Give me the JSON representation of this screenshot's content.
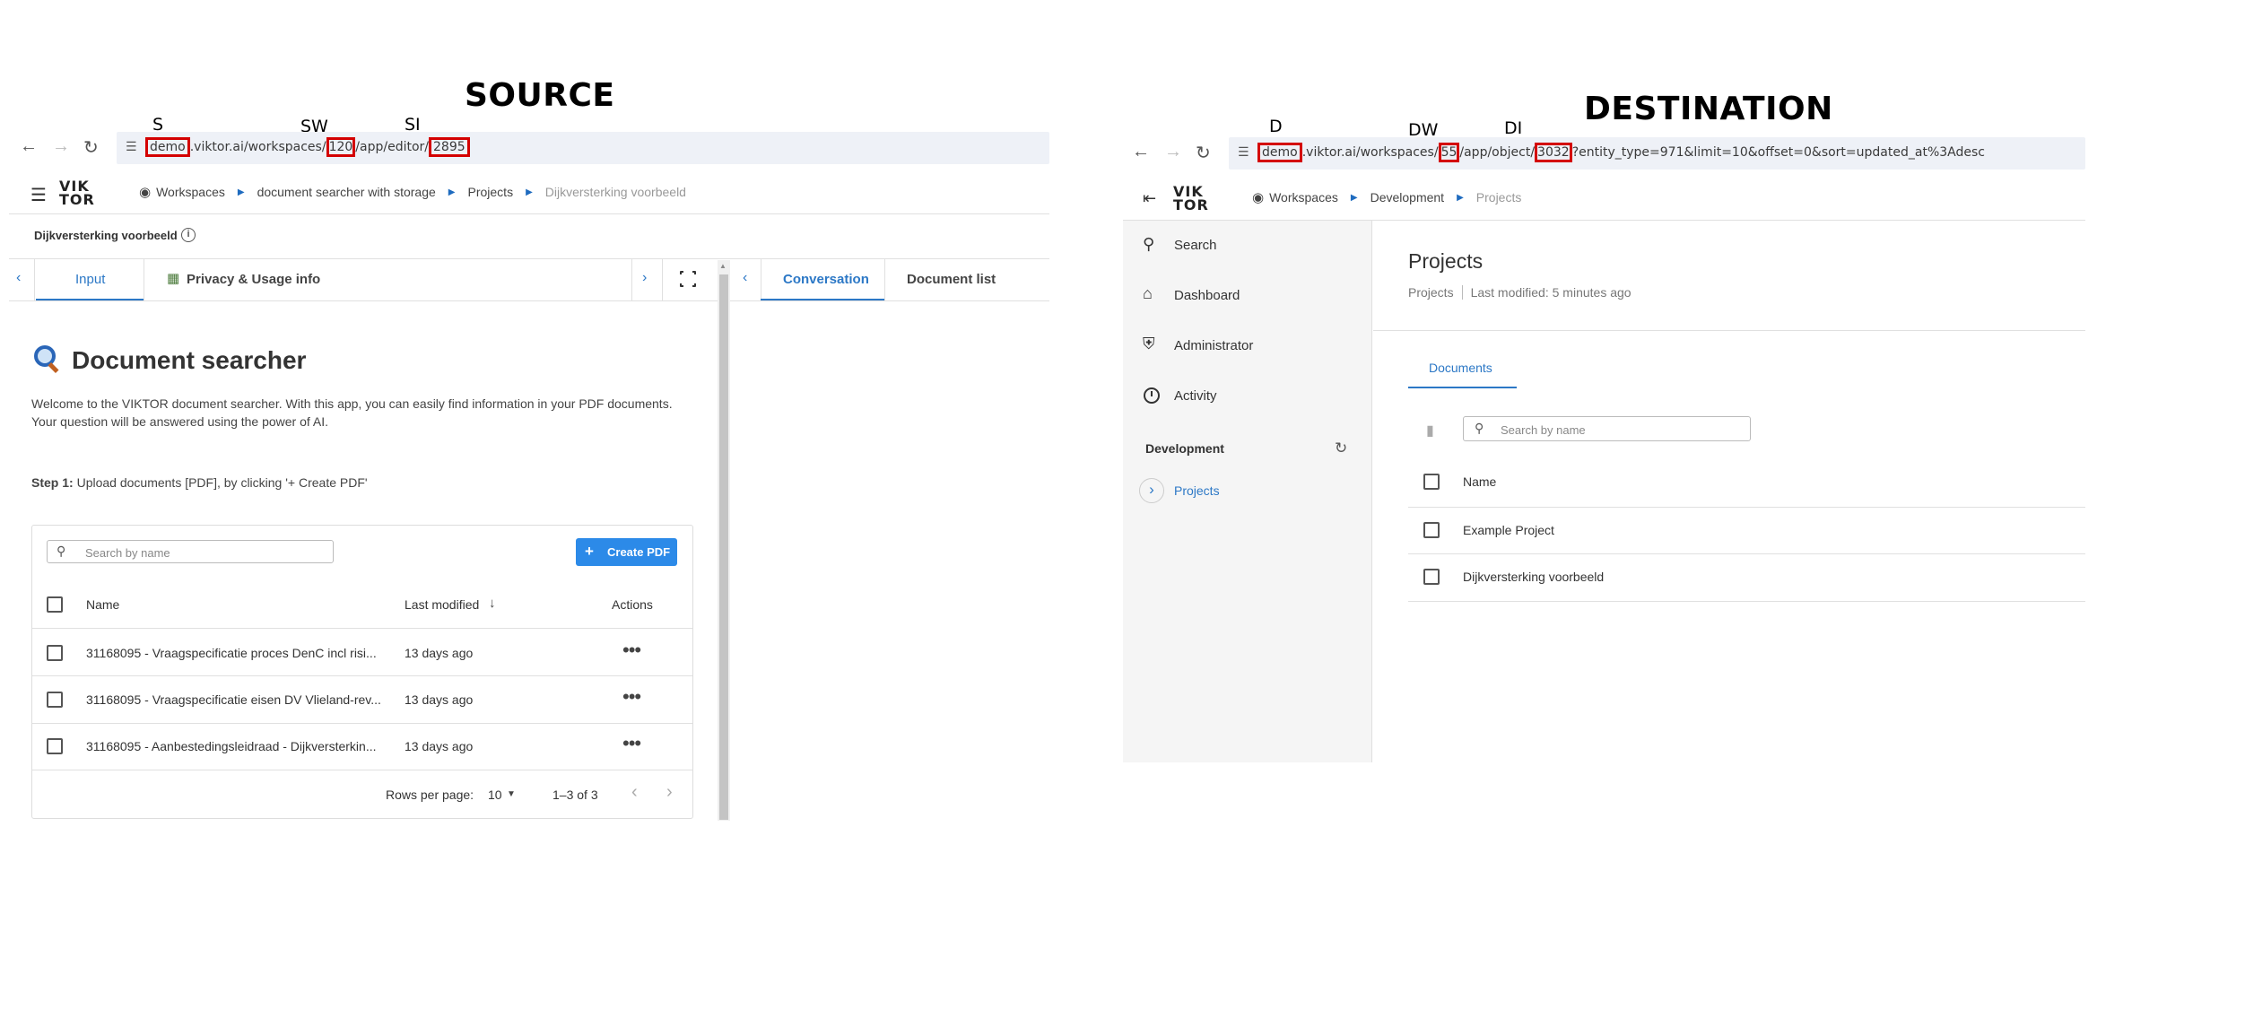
{
  "headings": {
    "source": "SOURCE",
    "destination": "DESTINATION"
  },
  "markers": {
    "source": {
      "s": "S",
      "sw": "SW",
      "si": "SI"
    },
    "destination": {
      "d": "D",
      "dw": "DW",
      "di": "DI"
    }
  },
  "source": {
    "url": {
      "part_domain": "demo",
      "part_1": ".viktor.ai/workspaces/",
      "part_workspace": "120",
      "part_2": "/app/editor/",
      "part_id": "2895"
    },
    "breadcrumb": {
      "workspaces": "Workspaces",
      "app": "document searcher with storage",
      "projects": "Projects",
      "current": "Dijkversterking voorbeeld"
    },
    "logo": {
      "line1": "VIK",
      "line2": "TOR"
    },
    "entity_title": "Dijkversterking voorbeeld",
    "tabs": {
      "input": "Input",
      "privacy": "Privacy & Usage info"
    },
    "right_tabs": {
      "conversation": "Conversation",
      "document_list": "Document list"
    },
    "app_title": "Document searcher",
    "intro": "Welcome to the VIKTOR document searcher. With this app, you can easily find information in your PDF documents. Your question will be answered using the power of AI.",
    "step_label": "Step 1:",
    "step_text": "Upload documents [PDF], by clicking '+ Create PDF'",
    "table": {
      "search_placeholder": "Search by name",
      "create_button": "Create PDF",
      "col_name": "Name",
      "col_modified": "Last modified",
      "col_actions": "Actions",
      "rows": [
        {
          "name": "31168095 - Vraagspecificatie proces DenC incl risi...",
          "modified": "13 days ago"
        },
        {
          "name": "31168095 - Vraagspecificatie eisen DV Vlieland-rev...",
          "modified": "13 days ago"
        },
        {
          "name": "31168095 - Aanbestedingsleidraad - Dijkversterkin...",
          "modified": "13 days ago"
        }
      ],
      "rows_per_page_label": "Rows per page:",
      "rows_per_page_value": "10",
      "range": "1–3 of 3"
    }
  },
  "destination": {
    "url": {
      "part_domain": "demo",
      "part_1": ".viktor.ai/workspaces/",
      "part_workspace": "55",
      "part_2": "/app/object/",
      "part_id": "3032",
      "part_3": "?entity_type=971&limit=10&offset=0&sort=updated_at%3Adesc"
    },
    "breadcrumb": {
      "workspaces": "Workspaces",
      "development": "Development",
      "projects": "Projects"
    },
    "logo": {
      "line1": "VIK",
      "line2": "TOR"
    },
    "sidebar": {
      "search": "Search",
      "dashboard": "Dashboard",
      "administrator": "Administrator",
      "activity": "Activity",
      "section": "Development",
      "projects": "Projects"
    },
    "page_title": "Projects",
    "subtitle_type": "Projects",
    "subtitle_modified": "Last modified: 5 minutes ago",
    "tab_documents": "Documents",
    "search_placeholder": "Search by name",
    "col_name": "Name",
    "rows": [
      "Example Project",
      "Dijkversterking voorbeeld"
    ]
  }
}
